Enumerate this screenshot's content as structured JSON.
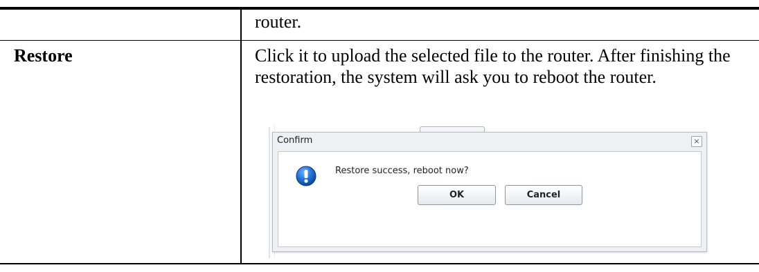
{
  "table": {
    "row1": {
      "label": "",
      "description": "router."
    },
    "row2": {
      "label": "Restore",
      "description": "Click it to upload the selected file to the router. After finishing the restoration, the system will ask you to reboot the router."
    }
  },
  "screenshot": {
    "dialog": {
      "title": "Confirm",
      "close_symbol": "×",
      "icon": "warning-exclamation-icon",
      "message": "Restore success, reboot now?",
      "ok_label": "OK",
      "cancel_label": "Cancel"
    }
  },
  "colors": {
    "icon_blue": "#1f6fd1",
    "dialog_bg": "#eef0f3",
    "dialog_border": "#b7bcc3"
  }
}
